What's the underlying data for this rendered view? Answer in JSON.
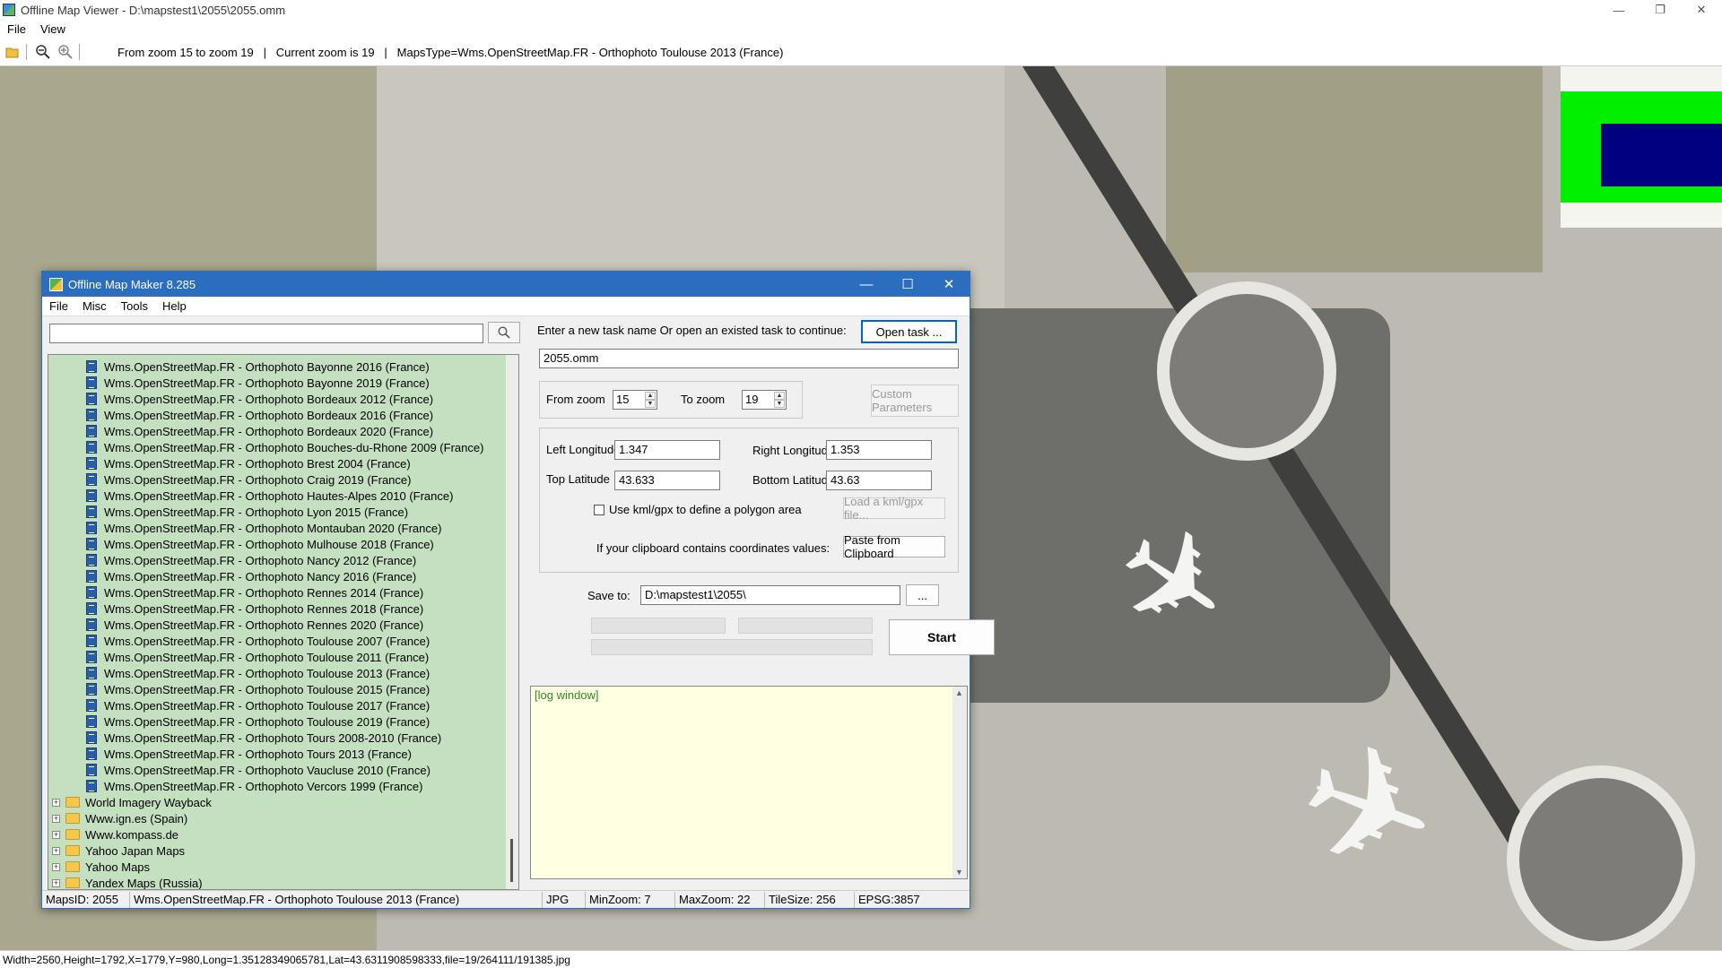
{
  "main_window": {
    "title": "Offline Map Viewer - D:\\mapstest1\\2055\\2055.omm",
    "controls": {
      "minimize": "—",
      "restore": "❐",
      "close": "✕"
    },
    "menu": [
      "File",
      "View"
    ],
    "toolbar": {
      "info": "From zoom 15 to zoom 19   |   Current zoom is 19   |   MapsType=Wms.OpenStreetMap.FR - Orthophoto Toulouse 2013 (France)"
    },
    "status": "Width=2560,Height=1792,X=1779,Y=980,Long=1.35128349065781,Lat=43.6311908598333,file=19/264111/191385.jpg"
  },
  "colors": {
    "overview_green": "#00f000",
    "overview_blue": "#000080",
    "tree_bg": "#c4e0c0",
    "log_bg": "#ffffe1",
    "dialog_title": "#2b6dbf"
  },
  "dialog": {
    "title": "Offline Map Maker 8.285",
    "controls": {
      "minimize": "—",
      "maximize": "☐",
      "close": "✕"
    },
    "menu": [
      "File",
      "Misc",
      "Tools",
      "Help"
    ],
    "search": {
      "value": "",
      "icon": "search-icon"
    },
    "tree": {
      "map_items": [
        "Wms.OpenStreetMap.FR - Orthophoto Bayonne 2016 (France)",
        "Wms.OpenStreetMap.FR - Orthophoto Bayonne 2019 (France)",
        "Wms.OpenStreetMap.FR - Orthophoto Bordeaux 2012 (France)",
        "Wms.OpenStreetMap.FR - Orthophoto Bordeaux 2016 (France)",
        "Wms.OpenStreetMap.FR - Orthophoto Bordeaux 2020 (France)",
        "Wms.OpenStreetMap.FR - Orthophoto Bouches-du-Rhone 2009 (France)",
        "Wms.OpenStreetMap.FR - Orthophoto Brest 2004 (France)",
        "Wms.OpenStreetMap.FR - Orthophoto Craig 2019 (France)",
        "Wms.OpenStreetMap.FR - Orthophoto Hautes-Alpes 2010 (France)",
        "Wms.OpenStreetMap.FR - Orthophoto Lyon 2015 (France)",
        "Wms.OpenStreetMap.FR - Orthophoto Montauban 2020 (France)",
        "Wms.OpenStreetMap.FR - Orthophoto Mulhouse 2018 (France)",
        "Wms.OpenStreetMap.FR - Orthophoto Nancy 2012 (France)",
        "Wms.OpenStreetMap.FR - Orthophoto Nancy 2016 (France)",
        "Wms.OpenStreetMap.FR - Orthophoto Rennes 2014 (France)",
        "Wms.OpenStreetMap.FR - Orthophoto Rennes 2018 (France)",
        "Wms.OpenStreetMap.FR - Orthophoto Rennes 2020 (France)",
        "Wms.OpenStreetMap.FR - Orthophoto Toulouse 2007 (France)",
        "Wms.OpenStreetMap.FR - Orthophoto Toulouse 2011 (France)",
        "Wms.OpenStreetMap.FR - Orthophoto Toulouse 2013 (France)",
        "Wms.OpenStreetMap.FR - Orthophoto Toulouse 2015 (France)",
        "Wms.OpenStreetMap.FR - Orthophoto Toulouse 2017 (France)",
        "Wms.OpenStreetMap.FR - Orthophoto Toulouse 2019 (France)",
        "Wms.OpenStreetMap.FR - Orthophoto Tours 2008-2010 (France)",
        "Wms.OpenStreetMap.FR - Orthophoto Tours 2013 (France)",
        "Wms.OpenStreetMap.FR - Orthophoto Vaucluse 2010 (France)",
        "Wms.OpenStreetMap.FR - Orthophoto Vercors 1999 (France)"
      ],
      "folders": [
        "World Imagery Wayback",
        "Www.ign.es (Spain)",
        "Www.kompass.de",
        "Yahoo Japan Maps",
        "Yahoo Maps",
        "Yandex Maps (Russia)"
      ]
    },
    "task_prompt": "Enter a new task name Or open an existed task to continue:",
    "open_task_button": "Open task ...",
    "task_name": "2055.omm",
    "from_zoom_label": "From zoom",
    "from_zoom": "15",
    "to_zoom_label": "To zoom",
    "to_zoom": "19",
    "custom_params_button": "Custom Parameters",
    "left_longitude_label": "Left Longitude",
    "left_longitude": "1.347",
    "right_longitude_label": "Right Longitude",
    "right_longitude": "1.353",
    "top_latitude_label": "Top Latitude",
    "top_latitude": "43.633",
    "bottom_latitude_label": "Bottom Latitude",
    "bottom_latitude": "43.63",
    "use_kml_label": "Use kml/gpx to define a polygon area",
    "use_kml_checked": false,
    "load_kml_button": "Load a kml/gpx file...",
    "clipboard_label": "If your clipboard contains coordinates values:",
    "paste_button": "Paste from Clipboard",
    "save_to_label": "Save to:",
    "save_to": "D:\\mapstest1\\2055\\",
    "browse_button": "...",
    "start_button": "Start",
    "log_text": "[log window]",
    "status": {
      "maps_id": "MapsID: 2055",
      "map_name": "Wms.OpenStreetMap.FR - Orthophoto Toulouse 2013 (France)",
      "format": "JPG",
      "min_zoom": "MinZoom: 7",
      "max_zoom": "MaxZoom: 22",
      "tile_size": "TileSize: 256",
      "epsg": "EPSG:3857"
    }
  }
}
